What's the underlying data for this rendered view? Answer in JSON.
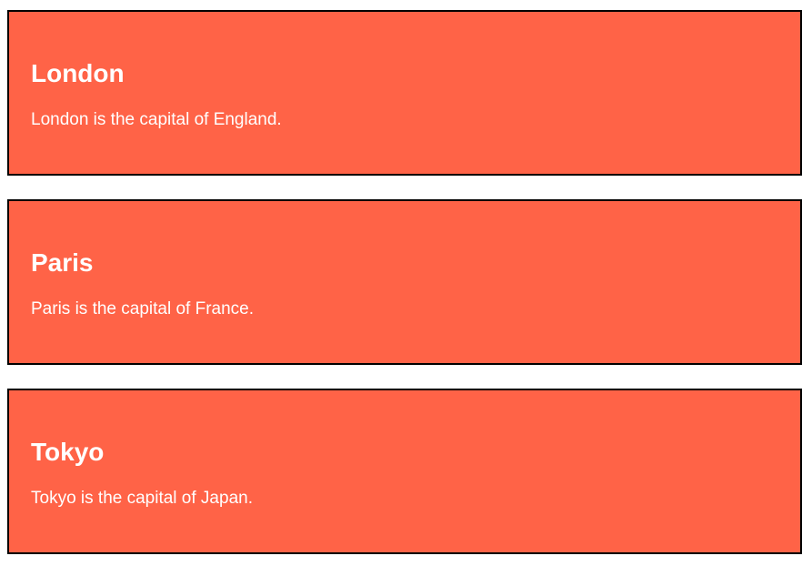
{
  "cities": [
    {
      "title": "London",
      "description": "London is the capital of England."
    },
    {
      "title": "Paris",
      "description": "Paris is the capital of France."
    },
    {
      "title": "Tokyo",
      "description": "Tokyo is the capital of Japan."
    }
  ],
  "colors": {
    "card_background": "#ff6347",
    "card_border": "#000000",
    "card_text": "#ffffff",
    "page_background": "#ffffff"
  }
}
